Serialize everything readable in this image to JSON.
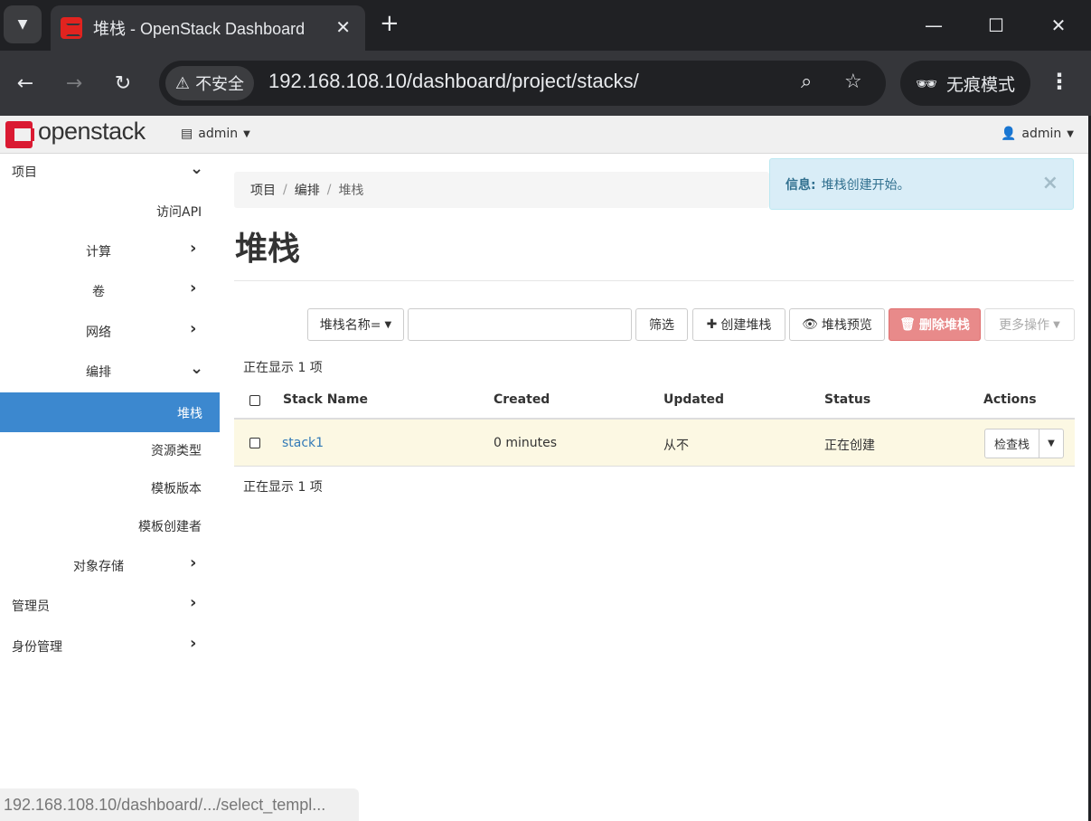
{
  "browser": {
    "tab_title": "堆栈 - OpenStack Dashboard",
    "tab_close": "✕",
    "new_tab": "+",
    "security_label": "不安全",
    "url": "192.168.108.10/dashboard/project/stacks/",
    "incognito_label": "无痕模式",
    "status_url": "192.168.108.10/dashboard/.../select_templ..."
  },
  "topnav": {
    "logo": "openstack",
    "project": "admin",
    "user": "admin"
  },
  "sidebar": {
    "items": [
      {
        "label": "项目",
        "chevron": "⌄"
      },
      {
        "label": "访问API",
        "chevron": ""
      },
      {
        "label": "计算",
        "chevron": "›"
      },
      {
        "label": "卷",
        "chevron": "›"
      },
      {
        "label": "网络",
        "chevron": "›"
      },
      {
        "label": "编排",
        "chevron": "⌄"
      },
      {
        "label": "堆栈",
        "chevron": ""
      },
      {
        "label": "资源类型",
        "chevron": ""
      },
      {
        "label": "模板版本",
        "chevron": ""
      },
      {
        "label": "模板创建者",
        "chevron": ""
      },
      {
        "label": "对象存储",
        "chevron": "›"
      },
      {
        "label": "管理员",
        "chevron": "›"
      },
      {
        "label": "身份管理",
        "chevron": "›"
      }
    ]
  },
  "breadcrumb": {
    "items": [
      "项目",
      "编排",
      "堆栈"
    ],
    "separator": "/"
  },
  "alert": {
    "title": "信息:",
    "message": "堆栈创建开始。",
    "close": "×"
  },
  "main": {
    "title": "堆栈",
    "filter_field": "堆栈名称=",
    "filter_value": "",
    "filter_button": "筛选",
    "create_button": "创建堆栈",
    "preview_button": "堆栈预览",
    "delete_button": "删除堆栈",
    "more_button": "更多操作",
    "count_top": "正在显示 1 项",
    "count_bottom": "正在显示 1 项"
  },
  "table": {
    "headers": [
      "Stack Name",
      "Created",
      "Updated",
      "Status",
      "Actions"
    ],
    "rows": [
      {
        "name": "stack1",
        "created": "0 minutes",
        "updated": "从不",
        "status": "正在创建",
        "action": "检查栈"
      }
    ]
  },
  "colors": {
    "accent": "#3c88cf",
    "danger": "#e88a8a",
    "info_bg": "#d9edf7",
    "row_highlight": "#fcf8e3",
    "link": "#337ab7"
  }
}
